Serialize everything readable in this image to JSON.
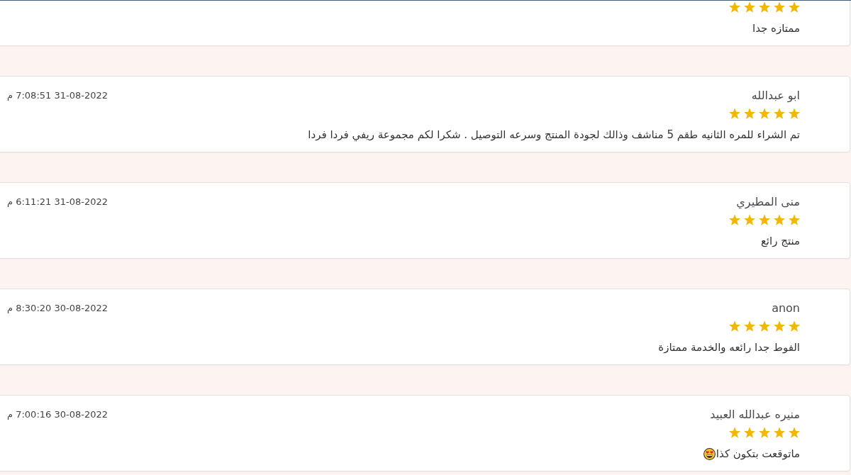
{
  "reviews": [
    {
      "stars": 5,
      "comment": "ممتازه جدا",
      "emoji": false
    },
    {
      "name": "ابو عبدالله",
      "timestamp": "31-08-2022 7:08:51 م",
      "stars": 5,
      "comment": "تم الشراء للمره الثانيه طقم 5 مناشف وذالك لجودة المنتج وسرعه التوصيل . شكرا لكم مجموعة ريفي فردا فردا",
      "emoji": false
    },
    {
      "name": "منى المطيري",
      "timestamp": "31-08-2022 6:11:21 م",
      "stars": 5,
      "comment": "منتج رائع",
      "emoji": false
    },
    {
      "name": "anon",
      "timestamp": "30-08-2022 8:30:20 م",
      "stars": 5,
      "comment": "الفوط جدا رائعه والخدمة ممتازة",
      "emoji": false
    },
    {
      "name": "منيره عبدالله العبيد",
      "timestamp": "30-08-2022 7:00:16 م",
      "stars": 5,
      "comment": "ماتوقعت بتكون كذا",
      "emoji": true
    }
  ]
}
